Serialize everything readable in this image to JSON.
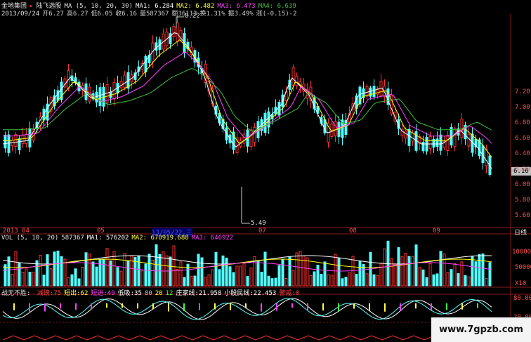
{
  "header": {
    "stock_code": "金地集团",
    "indicator_name": "陆飞选股",
    "ma_label": "MA (5, 10, 20, 30)",
    "ma1": "MA1: 6.284",
    "ma2": "MA2: 6.482",
    "ma3": "MA3: 6.473",
    "ma4": "MA4: 6.639",
    "date": "2013/09/24",
    "open": "开6.27",
    "high": "高6.27",
    "low": "低6.05",
    "close": "收6.16",
    "volume": "量587367",
    "amount": "额36113",
    "turnover": "换1.31%",
    "amplitude": "振3.49%",
    "change": "涨(-0.15)-2"
  },
  "price_axis": {
    "labels": [
      "7.20",
      "7.00",
      "6.80",
      "6.60",
      "6.40",
      "6.20",
      "6.00",
      "5.80",
      "5.60"
    ],
    "current_price": "6.16"
  },
  "annotations": {
    "high_marker": "8.22",
    "low_marker": "5.49"
  },
  "date_axis": {
    "labels": [
      "2013 04",
      "05",
      "13/05/22,三",
      "07",
      "08",
      "09"
    ],
    "period": "日线"
  },
  "volume_panel": {
    "title": "VOL (5, 10, 20)",
    "value": "587367",
    "ma1": "MA1: 576202",
    "ma2": "MA2: 670919.688",
    "ma3": "MA3: 646922",
    "axis_labels": [
      "100000",
      "50000"
    ],
    "multiplier": "X10"
  },
  "indicator_panel": {
    "title": "战无不胜:",
    "items": [
      {
        "label": "减磅:75",
        "color": "#ff4040"
      },
      {
        "label": "短出:62",
        "color": "#ffff40"
      },
      {
        "label": "短进:49",
        "color": "#ff40ff"
      },
      {
        "label": "低吸:35",
        "color": "#ffffff"
      },
      {
        "label": "80",
        "color": "#c0c0c0"
      },
      {
        "label": "20",
        "color": "#ffff40"
      },
      {
        "label": "12",
        "color": "#40ff40"
      },
      {
        "label": "庄家线:21.958",
        "color": "#ffffff"
      },
      {
        "label": "小股民线:22.453",
        "color": "#ffffff"
      },
      {
        "label": "警戒:0",
        "color": "#ff4040"
      }
    ],
    "axis_labels": [
      "80.00",
      "20.00"
    ]
  },
  "watermark": "www.7gpzb.com",
  "colors": {
    "up": "#ff3030",
    "down": "#54ffff",
    "ma1": "#ffffff",
    "ma2": "#ffff00",
    "ma3": "#ff40ff",
    "ma4": "#40c040",
    "grid": "#8b0000"
  }
}
